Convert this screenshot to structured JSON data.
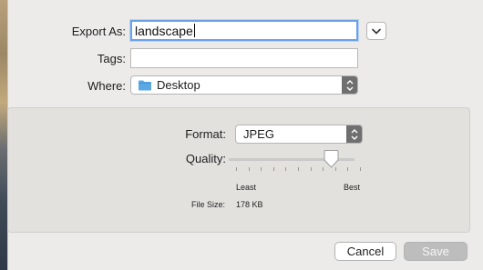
{
  "form": {
    "export_as_label": "Export As:",
    "export_as_value": "landscape",
    "tags_label": "Tags:",
    "tags_value": "",
    "where_label": "Where:",
    "where_value": "Desktop",
    "where_icon": "folder-icon"
  },
  "options": {
    "format_label": "Format:",
    "format_value": "JPEG",
    "quality_label": "Quality:",
    "quality_value_fraction": 0.77,
    "quality_min_label": "Least",
    "quality_max_label": "Best",
    "file_size_label": "File Size:",
    "file_size_value": "178 KB"
  },
  "buttons": {
    "cancel": "Cancel",
    "save": "Save"
  },
  "colors": {
    "focus_ring": "#6aa2e8",
    "folder": "#5aa9e6",
    "save_disabled": "#bdbdbd"
  }
}
